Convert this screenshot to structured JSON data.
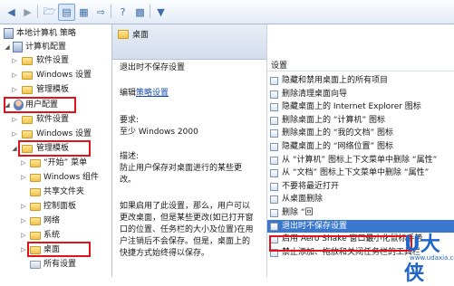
{
  "toolbar": {
    "icons": [
      "back-icon",
      "forward-icon",
      "up-folder-icon",
      "show-hide-tree-icon",
      "properties-icon",
      "export-list-icon",
      "help-icon",
      "show-pane-icon",
      "filter-icon"
    ]
  },
  "tree": {
    "root": "本地计算机 策略",
    "computer_config": "计算机配置",
    "cc_software": "软件设置",
    "cc_windows": "Windows 设置",
    "cc_admin": "管理模板",
    "user_config": "用户配置",
    "uc_software": "软件设置",
    "uc_windows": "Windows 设置",
    "uc_admin": "管理模板",
    "items": [
      "“开始” 菜单",
      "Windows 组件",
      "共享文件夹",
      "控制面板",
      "网络",
      "系统",
      "桌面",
      "所有设置"
    ]
  },
  "middle": {
    "header": "桌面",
    "setting_title": "退出时不保存设置",
    "edit_prefix": "编辑",
    "edit_link": "策略设置",
    "req_label": "要求:",
    "req_value": "至少 Windows 2000",
    "desc_label": "描述:",
    "desc_lines": [
      "防止用户保存对桌面进行的某些更",
      "改。",
      "",
      "如果启用了此设置，那么，用户可以",
      "更改桌面，但是某些更改(如已打开窗",
      "口的位置、任务栏的大小及位置)在用",
      "户注销后不会保存。但是，桌面上的",
      "快捷方式始终得以保存。"
    ]
  },
  "right": {
    "column_header": "设置",
    "rows": [
      "隐藏和禁用桌面上的所有项目",
      "删除清理桌面向导",
      "隐藏桌面上的 Internet Explorer 图标",
      "删除桌面上的 “计算机” 图标",
      "删除桌面上的 “我的文档” 图标",
      "隐藏桌面上的 “网络位置” 图标",
      "从 “计算机” 图标上下文菜单中删除 “属性”",
      "从 “文档” 图标上下文菜单中删除 “属性”",
      "不要将最近打开",
      "从桌面删除",
      "删除 “回",
      "退出时不保存设置",
      "启用 Aero Shake 窗口最小化鼠标手势",
      "禁止添加、拖放和关闭任务栏的工具栏"
    ],
    "selected_index": 11
  },
  "watermark": {
    "logo": "U大侠",
    "site": "www.udaxia.com"
  },
  "colors": {
    "highlight_box": "#e0131a",
    "selection": "#3a78cf",
    "link": "#1a4fb0"
  }
}
